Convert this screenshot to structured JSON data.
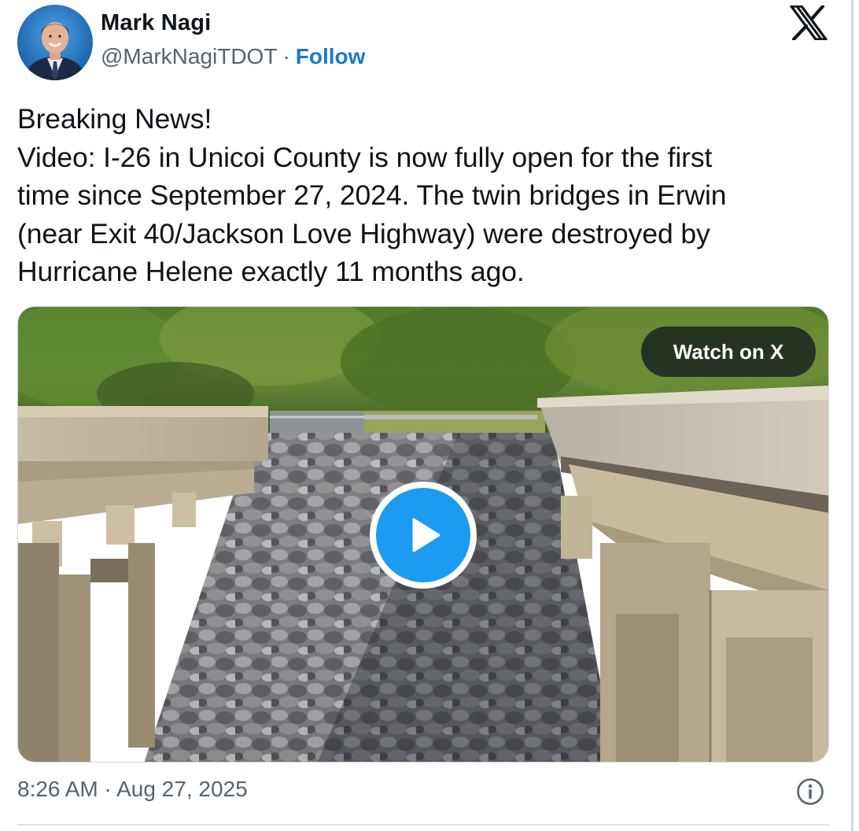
{
  "author": {
    "name": "Mark Nagi",
    "handle": "@MarkNagiTDOT",
    "separator": "·",
    "follow_label": "Follow"
  },
  "tweet": {
    "lines": [
      "Breaking News!",
      "Video: I-26 in Unicoi County is now fully open for the first",
      "time since September 27, 2024. The twin bridges in Erwin",
      "(near Exit 40/Jackson Love Highway) were destroyed by",
      "Hurricane Helene exactly 11 months ago."
    ]
  },
  "media": {
    "watch_label": "Watch on X"
  },
  "footer": {
    "timestamp": "8:26 AM · Aug 27, 2025"
  },
  "icons": {
    "brand": "x-logo-icon",
    "play": "play-icon",
    "info": "info-icon"
  },
  "colors": {
    "accent": "#1d9bf0",
    "follow": "#1d79c9",
    "secondary_text": "#536471",
    "primary_text": "#0f1419"
  }
}
